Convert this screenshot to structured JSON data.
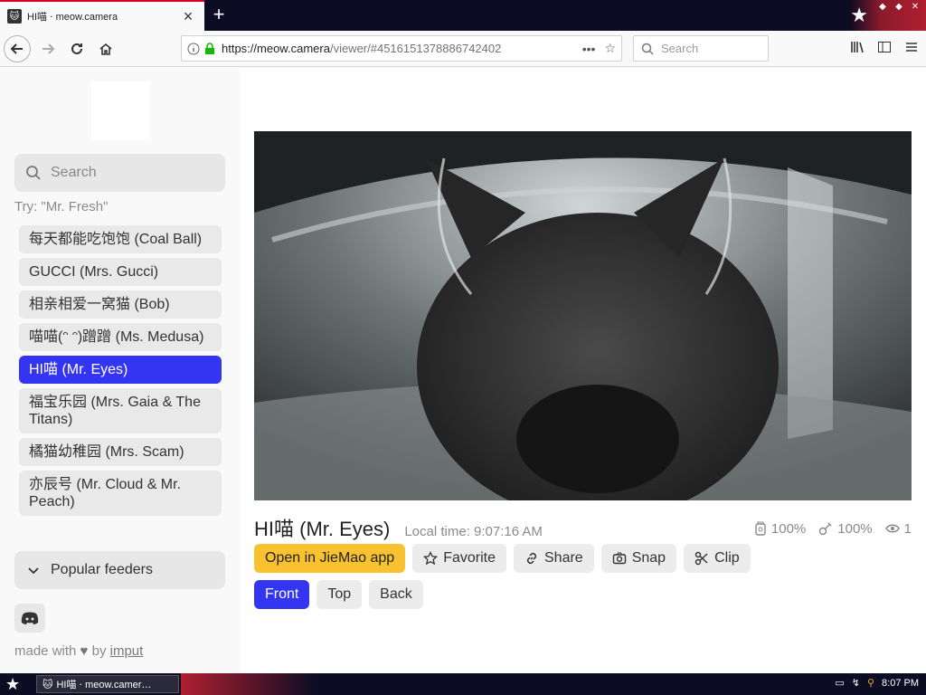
{
  "browser": {
    "tab_title": "HI喵 ‧ meow.camera",
    "url_host": "https://meow.camera",
    "url_path": "/viewer/#4516151378886742402",
    "search_placeholder": "Search"
  },
  "sidebar": {
    "search_placeholder": "Search",
    "try_hint": "Try: \"Mr. Fresh\"",
    "cameras": [
      {
        "label": "每天都能吃饱饱 (Coal Ball)",
        "active": false
      },
      {
        "label": "GUCCI (Mrs. Gucci)",
        "active": false
      },
      {
        "label": "相亲相爱一窝猫 (Bob)",
        "active": false
      },
      {
        "label": "喵喵(ᵔ ᵔ)蹭蹭 (Ms. Medusa)",
        "active": false
      },
      {
        "label": "HI喵 (Mr. Eyes)",
        "active": true
      },
      {
        "label": "福宝乐园 (Mrs. Gaia & The Titans)",
        "active": false
      },
      {
        "label": "橘猫幼稚园 (Mrs. Scam)",
        "active": false
      },
      {
        "label": "亦辰号 (Mr. Cloud & Mr. Peach)",
        "active": false
      }
    ],
    "popular_feeders": "Popular feeders",
    "footer_made_with": "made with",
    "footer_by": "by",
    "footer_author": "imput"
  },
  "viewer": {
    "title": "HI喵 (Mr. Eyes)",
    "local_time": "Local time: 9:07:16 AM",
    "stat_food": "100%",
    "stat_snack": "100%",
    "stat_viewers": "1",
    "buttons": {
      "open_app": "Open in JieMao app",
      "favorite": "Favorite",
      "share": "Share",
      "snap": "Snap",
      "clip": "Clip"
    },
    "views": {
      "front": "Front",
      "top": "Top",
      "back": "Back"
    }
  },
  "taskbar": {
    "task_title": "HI喵 ‧ meow.camer…",
    "clock": "8:07 PM"
  },
  "colors": {
    "accent_blue": "#3335f2",
    "app_yellow": "#f7c12f",
    "tab_red": "#d70022"
  }
}
